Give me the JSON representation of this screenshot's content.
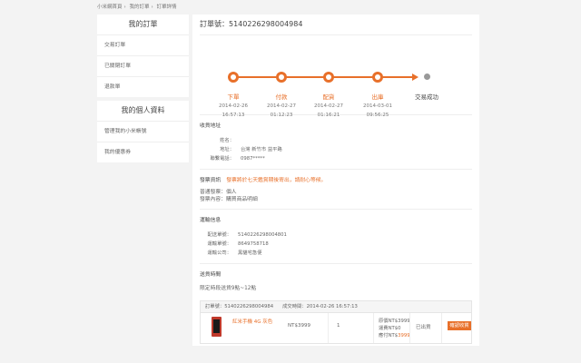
{
  "breadcrumb": [
    "小米網首頁",
    "我的訂單",
    "訂單詳情"
  ],
  "sidebar": {
    "orders_header": "我的訂單",
    "order_items": [
      {
        "label": "交易訂單"
      },
      {
        "label": "已關閉訂單"
      },
      {
        "label": "退款單"
      }
    ],
    "profile_header": "我的個人資料",
    "profile_items": [
      {
        "label": "管理我的小米帳號"
      },
      {
        "label": "我的優惠券"
      }
    ]
  },
  "order": {
    "title": "訂單號：5140226298004984"
  },
  "progress": {
    "accent": "#e8702a",
    "steps": [
      {
        "label": "下單",
        "date": "2014-02-26",
        "time": "16:57:13"
      },
      {
        "label": "付款",
        "date": "2014-02-27",
        "time": "01:12:23"
      },
      {
        "label": "配貨",
        "date": "2014-02-27",
        "time": "01:16:21"
      },
      {
        "label": "出庫",
        "date": "2014-03-01",
        "time": "09:56:25"
      },
      {
        "label": "交易成功"
      }
    ]
  },
  "shipping": {
    "title": "收貨地址",
    "name_label": "姓名：",
    "name_value": "",
    "address_label": "地址：",
    "address_value": "台灣 新竹市 益平路",
    "phone_label": "聯繫電話：",
    "phone_value": "0987*****"
  },
  "invoice": {
    "title": "發票資訊",
    "note": "發票將於七天鑑賞期後寄出，請耐心等候。",
    "type": "普通發票：個人",
    "content": "發票內容：購買商品明細"
  },
  "delivery": {
    "title": "運輸信息",
    "ship_no_label": "配送單號：",
    "ship_no_value": "5140226298004801",
    "tracking_label": "運輸單號：",
    "tracking_value": "8649758718",
    "carrier_label": "運輸公司：",
    "carrier_value": "黑貓宅急便"
  },
  "delivery_time": {
    "title": "送貨時間",
    "value": "限定時段送貨9點~12點"
  },
  "order_table": {
    "order_no": "訂單號：5140226298004984",
    "deal_time": "成交時間：2014-02-26 16:57:13",
    "product_name": "紅米手機 4G 灰色",
    "price": "NT$3999",
    "quantity": "1",
    "original_price": "原價NT$3999",
    "shipping_fee": "運費NT$0",
    "paid_label": "應付NT$",
    "paid_value": "3999",
    "status": "已出貨",
    "receipt_button": "確認收貨"
  }
}
